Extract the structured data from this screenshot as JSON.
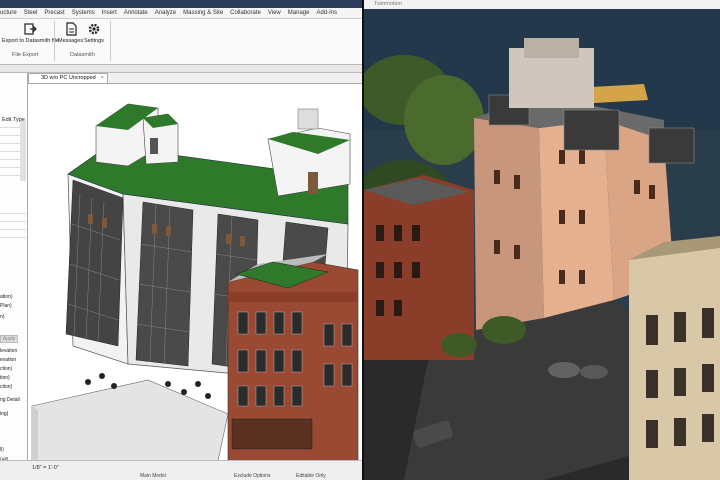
{
  "revit": {
    "ribbon_tabs": [
      "ucture",
      "Steel",
      "Precast",
      "Systems",
      "Insert",
      "Annotate",
      "Analyze",
      "Massing & Site",
      "Collaborate",
      "View",
      "Manage",
      "Add-Ins"
    ],
    "buttons": {
      "export_label": "Export to Datasmith file",
      "messages_label": "Messages",
      "settings_label": "Settings"
    },
    "panels": {
      "file_export": "File Export",
      "datasmith": "Datasmith"
    },
    "properties": {
      "edit_type": "Edit Type",
      "apply": "Apply",
      "items": [
        "ation)",
        "Plan)",
        "n)",
        "levation",
        "evation",
        "ction)",
        "tion)",
        "ction)",
        "ng Detail",
        "ing)",
        "ll)",
        "(all)"
      ]
    },
    "view_tab": {
      "label": "3D w/o PC Uncropped",
      "close": "×"
    },
    "status": {
      "scale": "1/8\" = 1'-0\"",
      "main_model": "Main Model",
      "exclude_options": "Exclude Options",
      "editable_only": "Editable Only"
    }
  },
  "twinmotion": {
    "title": "Twinmotion"
  },
  "colors": {
    "titlebar": "#2b3c5a",
    "roof_green": "#2f7a2a",
    "brick": "#9a4a32"
  }
}
